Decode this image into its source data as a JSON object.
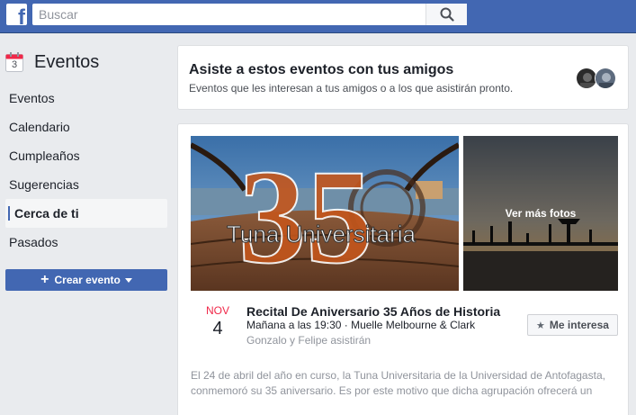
{
  "topbar": {
    "logo": "f",
    "search_placeholder": "Buscar"
  },
  "sidebar": {
    "title": "Eventos",
    "calendar_day": "3",
    "items": [
      {
        "label": "Eventos"
      },
      {
        "label": "Calendario"
      },
      {
        "label": "Cumpleaños"
      },
      {
        "label": "Sugerencias"
      },
      {
        "label": "Cerca de ti",
        "active": true
      },
      {
        "label": "Pasados"
      }
    ],
    "create_label": "Crear evento"
  },
  "friends_card": {
    "title": "Asiste a estos eventos con tus amigos",
    "subtitle": "Eventos que les interesan a tus amigos o a los que asistirán pronto."
  },
  "event": {
    "photo_text": "Tuna Universitaria",
    "photo_number": "35",
    "see_more": "Ver más fotos",
    "month": "NOV",
    "day": "4",
    "title": "Recital De Aniversario 35 Años de Historia",
    "when_where": "Mañana a las 19:30 · Muelle Melbourne & Clark",
    "friends": "Gonzalo y Felipe asistirán",
    "interest_label": "Me interesa",
    "description": "El 24 de abril del año en curso, la Tuna Universitaria de la Universidad de Antofagasta, conmemoró su 35 aniversario. Es por este motivo que dicha agrupación ofrecerá un"
  },
  "colors": {
    "brand": "#4267b2",
    "date_month": "#f02849",
    "background": "#e9ebee"
  }
}
